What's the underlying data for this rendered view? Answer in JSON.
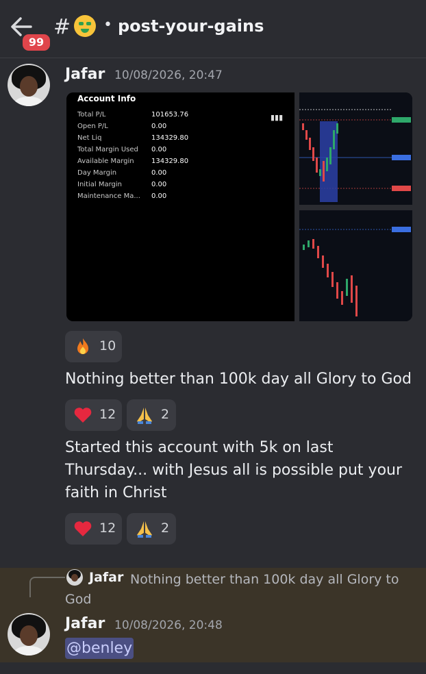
{
  "header": {
    "badge_count": "99",
    "hash": "#",
    "separator": "•",
    "channel_name": "post-your-gains",
    "channel_emoji": "money-mouth-face-icon"
  },
  "message1": {
    "author": "Jafar",
    "timestamp": "10/08/2026, 20:47",
    "account_info": {
      "title": "Account Info",
      "rows": [
        {
          "label": "Total P/L",
          "value": "101653.76"
        },
        {
          "label": "Open P/L",
          "value": "0.00"
        },
        {
          "label": "Net Liq",
          "value": "134329.80"
        },
        {
          "label": "Total Margin Used",
          "value": "0.00"
        },
        {
          "label": "Available Margin",
          "value": "134329.80"
        },
        {
          "label": "Day Margin",
          "value": "0.00"
        },
        {
          "label": "Initial Margin",
          "value": "0.00"
        },
        {
          "label": "Maintenance Ma...",
          "value": "0.00"
        }
      ]
    },
    "reactions": [
      {
        "icon": "fire-icon",
        "count": "10"
      }
    ]
  },
  "message2": {
    "text": "Nothing better than 100k day all Glory to God",
    "reactions": [
      {
        "icon": "heart-icon",
        "count": "12"
      },
      {
        "icon": "praying-hands-icon",
        "count": "2"
      }
    ]
  },
  "message3": {
    "lines": [
      "Started this account with 5k on last",
      "Thursday... with Jesus all is possible put your",
      "faith in Christ"
    ],
    "reactions": [
      {
        "icon": "heart-icon",
        "count": "12"
      },
      {
        "icon": "praying-hands-icon",
        "count": "2"
      }
    ]
  },
  "reply": {
    "quoted_author": "Jafar",
    "quoted_text": "Nothing better than 100k day all Glory to God",
    "author": "Jafar",
    "timestamp": "10/08/2026, 20:48",
    "mention": "@benley"
  },
  "colors": {
    "background": "#2b2c31",
    "reply_highlight": "#3b3428",
    "badge": "#e0454b",
    "mention_bg": "#4b4f83"
  }
}
